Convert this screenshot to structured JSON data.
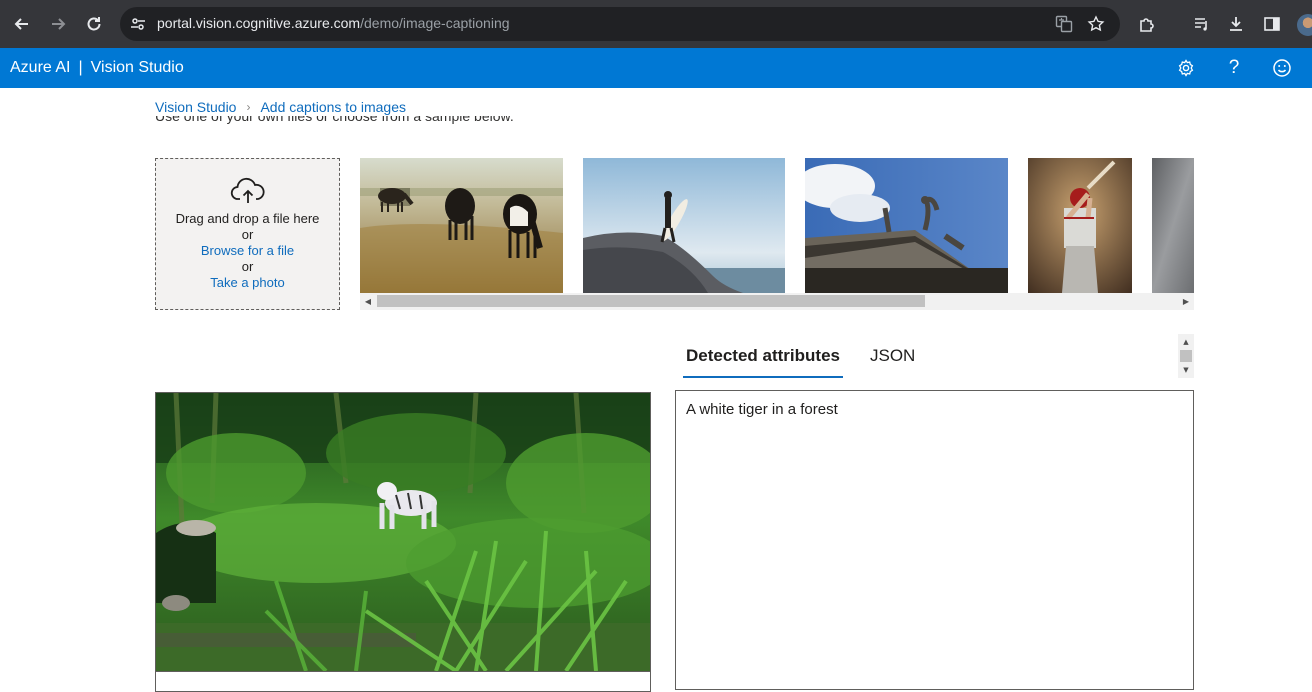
{
  "browser": {
    "url_host": "portal.vision.cognitive.azure.com",
    "url_path": "/demo/image-captioning"
  },
  "app": {
    "brand": "Azure AI",
    "separator": "|",
    "product": "Vision Studio"
  },
  "breadcrumb": {
    "home": "Vision Studio",
    "current": "Add captions to images"
  },
  "intro_text": "Use one of your own files or choose from a sample below.",
  "dropzone": {
    "drag_text": "Drag and drop a file here",
    "or_1": "or",
    "browse_link": "Browse for a file",
    "or_2": "or",
    "photo_link": "Take a photo"
  },
  "samples": [
    {
      "name": "cows-in-field"
    },
    {
      "name": "surfer-on-rock"
    },
    {
      "name": "building-statues"
    },
    {
      "name": "baseball-batter"
    },
    {
      "name": "grey-sample"
    }
  ],
  "tabs": [
    {
      "label": "Detected attributes",
      "active": true
    },
    {
      "label": "JSON",
      "active": false
    }
  ],
  "result": {
    "caption": "A white tiger in a forest"
  },
  "colors": {
    "accent": "#0078d4",
    "link": "#0f6cbd",
    "chrome": "#35363a"
  }
}
